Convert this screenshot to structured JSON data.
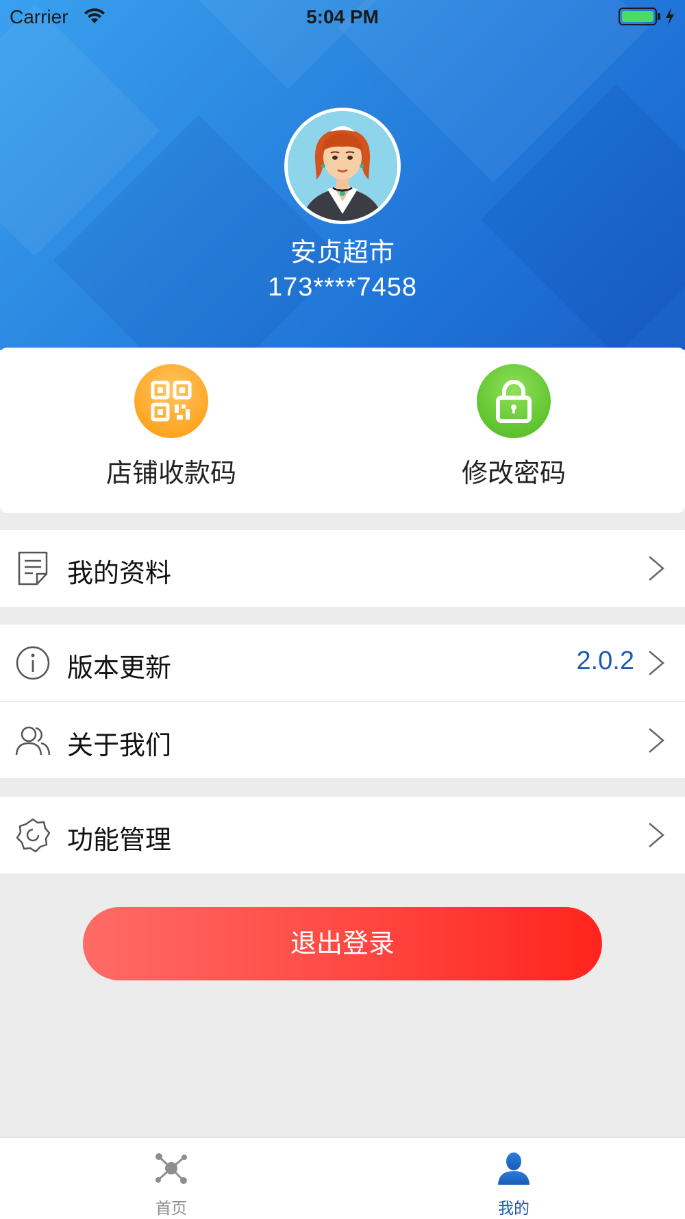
{
  "status_bar": {
    "carrier": "Carrier",
    "time": "5:04 PM"
  },
  "profile": {
    "store_name": "安贞超市",
    "phone": "173****7458"
  },
  "quick_actions": [
    {
      "label": "店铺收款码",
      "icon": "qr-code-icon",
      "color": "#ffa624"
    },
    {
      "label": "修改密码",
      "icon": "lock-icon",
      "color": "#5fc42f"
    }
  ],
  "menu": {
    "profile_label": "我的资料",
    "version_label": "版本更新",
    "version_value": "2.0.2",
    "about_label": "关于我们",
    "features_label": "功能管理"
  },
  "logout_label": "退出登录",
  "tabs": [
    {
      "label": "首页",
      "icon": "home-network-icon",
      "active": false
    },
    {
      "label": "我的",
      "icon": "user-icon",
      "active": true
    }
  ],
  "colors": {
    "accent": "#1a5bb5",
    "header": "#2a86e0",
    "logout": "#ff3b35",
    "background": "#ececec"
  }
}
